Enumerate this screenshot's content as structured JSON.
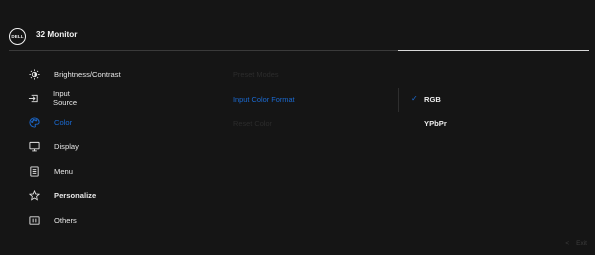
{
  "header": {
    "logo_text": "DELL",
    "title": "32 Monitor"
  },
  "menu": {
    "items": [
      {
        "label": "Brightness/Contrast",
        "icon": "brightness-icon"
      },
      {
        "label": "Input Source",
        "icon": "input-source-icon"
      },
      {
        "label": "Color",
        "icon": "color-icon",
        "active": true
      },
      {
        "label": "Display",
        "icon": "display-icon"
      },
      {
        "label": "Menu",
        "icon": "menu-icon"
      },
      {
        "label": "Personalize",
        "icon": "star-icon"
      },
      {
        "label": "Others",
        "icon": "others-icon"
      }
    ]
  },
  "submenu": {
    "items": [
      {
        "label": "Preset Modes"
      },
      {
        "label": "Input Color Format",
        "selected": true
      },
      {
        "label": "Reset Color"
      }
    ]
  },
  "options": {
    "items": [
      {
        "label": "RGB",
        "checked": true
      },
      {
        "label": "YPbPr"
      }
    ],
    "check_symbol": "✓"
  },
  "footer": {
    "exit_chevron": "<",
    "exit_label": "Exit"
  },
  "colors": {
    "accent": "#1b6ad1",
    "background": "#151515",
    "text": "#e8e8e8"
  }
}
